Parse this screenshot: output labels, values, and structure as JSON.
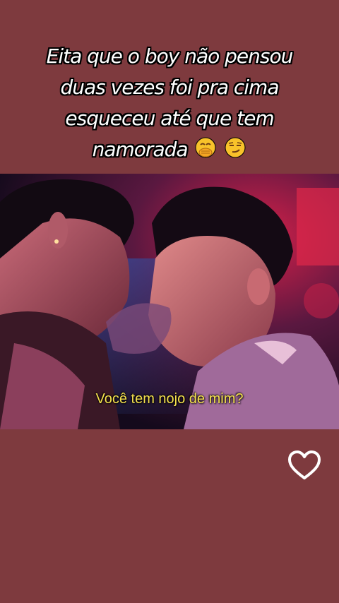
{
  "caption": {
    "lines": [
      "Eita que o boy não pensou",
      "duas vezes foi pra cima",
      "esqueceu até que tem",
      "namorada"
    ],
    "emojis": [
      "hand-over-mouth-emoji",
      "smirking-face-emoji"
    ]
  },
  "video": {
    "subtitle": "Você tem nojo de mim?"
  },
  "icons": {
    "like": "heart-outline-icon"
  },
  "colors": {
    "background": "#7e3a3e",
    "subtitle": "#f4e04d",
    "caption_text": "#ffffff"
  }
}
